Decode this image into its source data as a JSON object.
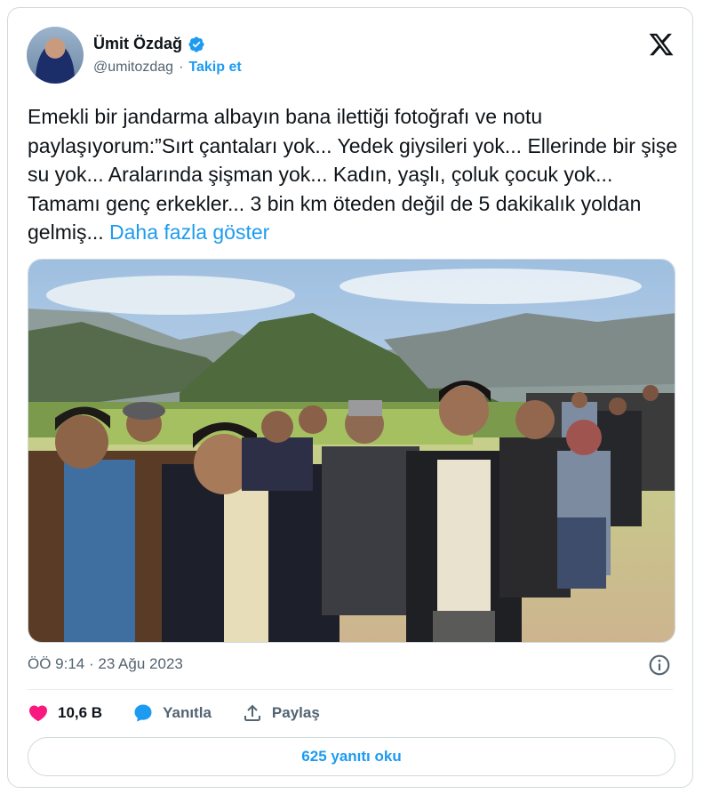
{
  "author": {
    "name": "Ümit Özdağ",
    "handle": "@umitozdag",
    "separator": "·",
    "follow_label": "Takip et"
  },
  "tweet": {
    "text": "Emekli bir jandarma albayın bana ilettiği fotoğrafı ve notu paylaşıyorum:”Sırt çantaları yok... Yedek giysileri yok... Ellerinde bir şişe su yok... Aralarında şişman yok... Kadın, yaşlı, çoluk çocuk yok... Tamamı genç erkekler... 3 bin km öteden değil de 5 dakikalık yoldan gelmiş...",
    "show_more": "Daha fazla göster",
    "timestamp": "ÖÖ 9:14 · 23 Ağu 2023"
  },
  "actions": {
    "likes": "10,6 B",
    "reply_label": "Yanıtla",
    "share_label": "Paylaş"
  },
  "read_replies_label": "625 yanıtı oku",
  "icons": {
    "verified": "verified-badge-icon",
    "logo": "x-logo-icon",
    "info": "info-icon",
    "like": "heart-icon",
    "reply": "reply-bubble-icon",
    "share": "share-icon"
  },
  "colors": {
    "accent": "#1d9bf0",
    "like": "#f91880",
    "muted": "#536471"
  }
}
